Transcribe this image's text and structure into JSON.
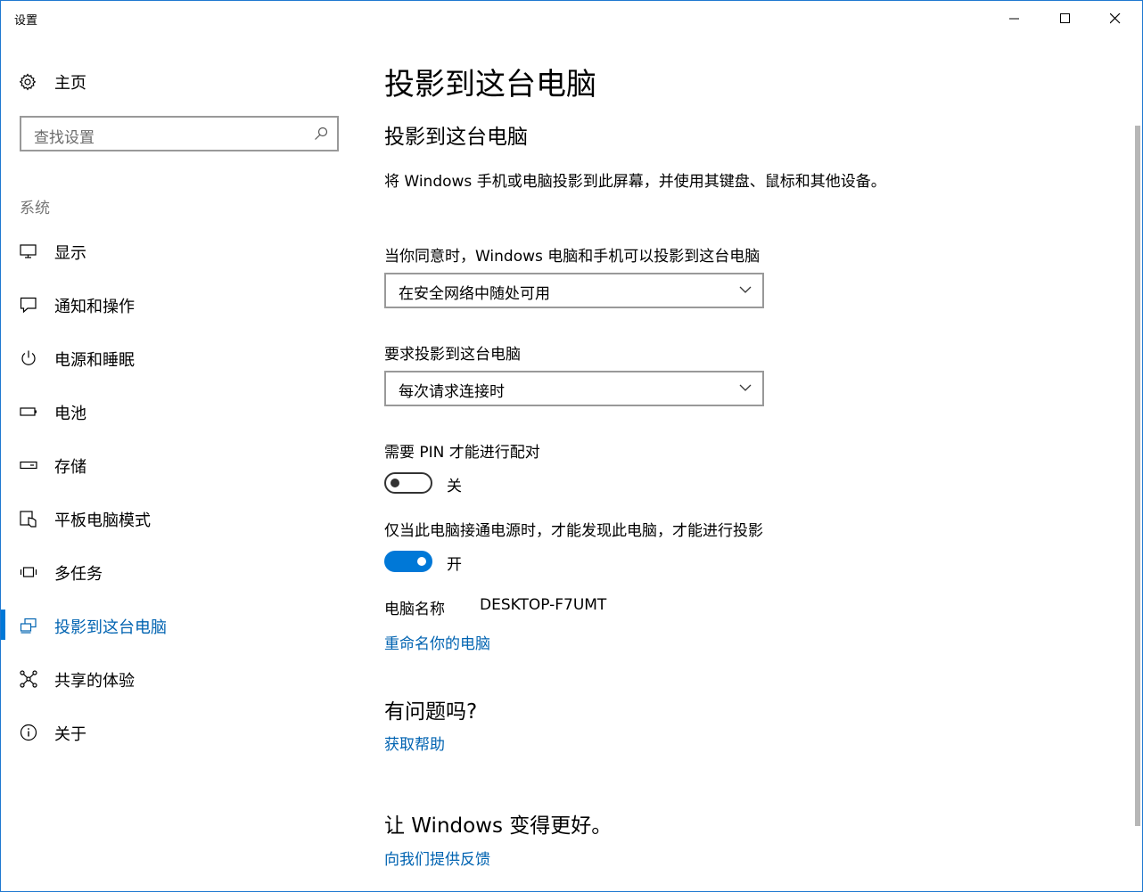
{
  "window": {
    "title": "设置"
  },
  "sidebar": {
    "home_label": "主页",
    "search_placeholder": "查找设置",
    "section_label": "系统",
    "items": [
      {
        "label": "显示",
        "icon": "monitor-icon"
      },
      {
        "label": "通知和操作",
        "icon": "notification-icon"
      },
      {
        "label": "电源和睡眠",
        "icon": "power-icon"
      },
      {
        "label": "电池",
        "icon": "battery-icon"
      },
      {
        "label": "存储",
        "icon": "storage-icon"
      },
      {
        "label": "平板电脑模式",
        "icon": "tablet-mode-icon"
      },
      {
        "label": "多任务",
        "icon": "multitasking-icon"
      },
      {
        "label": "投影到这台电脑",
        "icon": "project-icon",
        "active": true
      },
      {
        "label": "共享的体验",
        "icon": "shared-experiences-icon"
      },
      {
        "label": "关于",
        "icon": "info-icon"
      }
    ]
  },
  "main": {
    "page_title": "投影到这台电脑",
    "section_title": "投影到这台电脑",
    "description": "将 Windows 手机或电脑投影到此屏幕，并使用其键盘、鼠标和其他设备。",
    "availability": {
      "label": "当你同意时，Windows 电脑和手机可以投影到这台电脑",
      "selected": "在安全网络中随处可用"
    },
    "ask_to_project": {
      "label": "要求投影到这台电脑",
      "selected": "每次请求连接时"
    },
    "require_pin": {
      "label": "需要 PIN 才能进行配对",
      "state": "关",
      "on": false
    },
    "plugged_in_only": {
      "label": "仅当此电脑接通电源时，才能发现此电脑，才能进行投影",
      "state": "开",
      "on": true
    },
    "pc_name": {
      "label": "电脑名称",
      "value": "DESKTOP-F7UMT"
    },
    "rename_link": "重命名你的电脑",
    "questions": {
      "heading": "有问题吗?",
      "link": "获取帮助"
    },
    "feedback": {
      "heading": "让 Windows 变得更好。",
      "link": "向我们提供反馈"
    }
  },
  "colors": {
    "accent": "#0078d7",
    "link": "#0063b1",
    "border": "#999999"
  }
}
